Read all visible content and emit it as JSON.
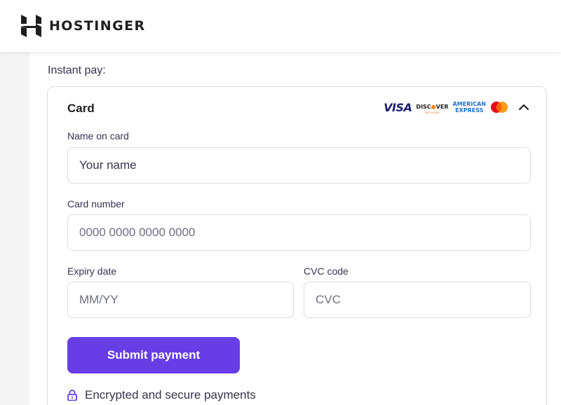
{
  "header": {
    "brand_name": "HOSTINGER",
    "logo_icon": "hostinger-logo-icon"
  },
  "payment": {
    "section_label": "Instant pay:",
    "card_title": "Card",
    "brands": {
      "visa": "VISA",
      "discover_main_1": "DISC",
      "discover_main_2": "VER",
      "discover_sub": "NETWORK",
      "amex_line1": "AMERICAN",
      "amex_line2": "EXPRESS",
      "mastercard_icon": "mastercard-icon",
      "collapse_icon": "chevron-up-icon"
    },
    "fields": {
      "name": {
        "label": "Name on card",
        "placeholder": "Your name",
        "value": ""
      },
      "number": {
        "label": "Card number",
        "placeholder": "0000 0000 0000 0000",
        "value": ""
      },
      "expiry": {
        "label": "Expiry date",
        "placeholder": "MM/YY",
        "value": ""
      },
      "cvc": {
        "label": "CVC code",
        "placeholder": "CVC",
        "value": ""
      }
    },
    "submit_label": "Submit payment",
    "secure_text": "Encrypted and secure payments",
    "secure_icon": "lock-icon"
  },
  "colors": {
    "accent": "#673de6",
    "text": "#1d1e20",
    "muted_text": "#36344d",
    "border": "#dadce0",
    "page_bg": "#f4f4f5"
  }
}
